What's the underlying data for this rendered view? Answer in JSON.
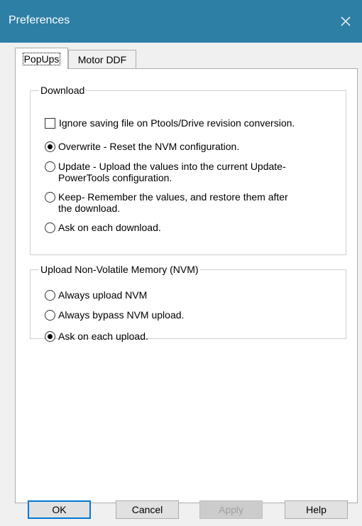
{
  "window": {
    "title": "Preferences",
    "close_icon": "close-icon",
    "titlebar_color": "#2e7fa6"
  },
  "tabs": [
    {
      "label": "PopUps",
      "active": true
    },
    {
      "label": "Motor DDF",
      "active": false
    }
  ],
  "download": {
    "legend": "Download",
    "ignore_checkbox": {
      "label": "Ignore saving file on Ptools/Drive revision conversion.",
      "checked": false
    },
    "options": [
      {
        "line1": "Overwrite - Reset the NVM configuration.",
        "line2": "",
        "checked": true
      },
      {
        "line1": "Update - Upload the values into the current Update-",
        "line2": "PowerTools configuration.",
        "checked": false
      },
      {
        "line1": "Keep- Remember the values, and restore them after",
        "line2": "the download.",
        "checked": false
      },
      {
        "line1": "Ask on each download.",
        "line2": "",
        "checked": false
      }
    ]
  },
  "upload": {
    "legend": "Upload Non-Volatile Memory (NVM)",
    "options": [
      {
        "label": "Always upload NVM",
        "checked": false
      },
      {
        "label": "Always bypass NVM upload.",
        "checked": false
      },
      {
        "label": "Ask on each upload.",
        "checked": true
      }
    ]
  },
  "buttons": {
    "ok": "OK",
    "cancel": "Cancel",
    "apply": "Apply",
    "help": "Help"
  },
  "colors": {
    "default_button_border": "#0078d7",
    "disabled_text": "#a0a0a0"
  }
}
